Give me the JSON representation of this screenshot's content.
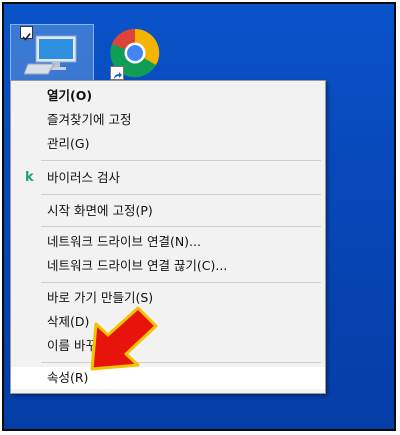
{
  "desktop": {
    "icons": [
      {
        "name": "this-pc",
        "selected": true
      },
      {
        "name": "chrome",
        "shortcut": true
      }
    ]
  },
  "context_menu": {
    "items": [
      {
        "label": "열기(O)",
        "bold": true
      },
      {
        "label": "즐겨찾기에 고정"
      },
      {
        "label": "관리(G)"
      },
      {
        "label": "바이러스 검사",
        "icon": "k"
      },
      {
        "label": "시작 화면에 고정(P)"
      },
      {
        "label": "네트워크 드라이브 연결(N)..."
      },
      {
        "label": "네트워크 드라이브 연결 끊기(C)..."
      },
      {
        "label": "바로 가기 만들기(S)"
      },
      {
        "label": "삭제(D)"
      },
      {
        "label": "이름 바꾸기(M)"
      },
      {
        "label": "속성(R)",
        "highlighted": true
      }
    ]
  },
  "colors": {
    "desktop": "#0747b8",
    "menu_bg": "#f2f2f2",
    "arrow_fill": "#e8140c",
    "arrow_stroke": "#f2c400",
    "kaspersky": "#1aa37a"
  }
}
